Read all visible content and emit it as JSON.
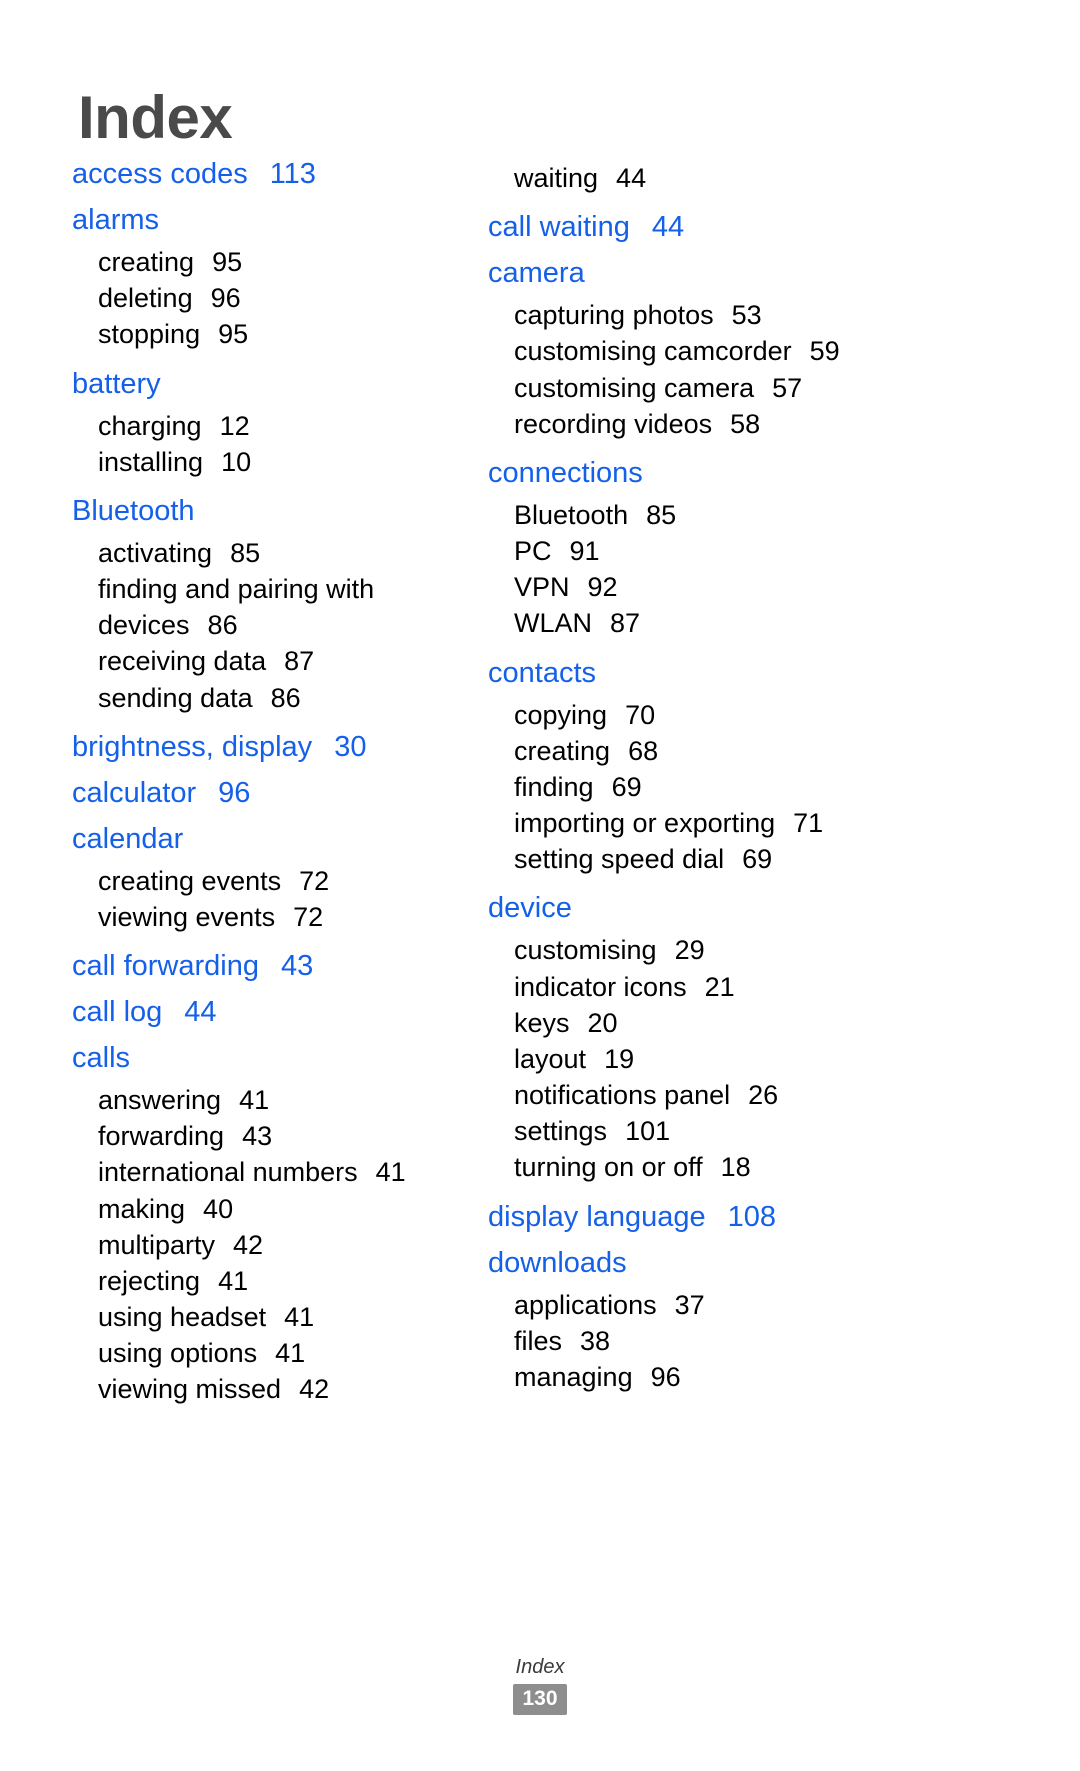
{
  "page": {
    "title": "Index",
    "footer_label": "Index",
    "footer_page_number": "130",
    "headword_color": "#1560e8",
    "title_color": "#4a4a4a",
    "subentry_color": "#000000",
    "page_box_color": "#8e8e8e"
  },
  "columns": [
    {
      "name": "left",
      "entries": [
        {
          "term": "access codes",
          "page": "113",
          "subentries": []
        },
        {
          "term": "alarms",
          "page": "",
          "subentries": [
            {
              "label": "creating",
              "page": "95"
            },
            {
              "label": "deleting",
              "page": "96"
            },
            {
              "label": "stopping",
              "page": "95"
            }
          ]
        },
        {
          "term": "battery",
          "page": "",
          "subentries": [
            {
              "label": "charging",
              "page": "12"
            },
            {
              "label": "installing",
              "page": "10"
            }
          ]
        },
        {
          "term": "Bluetooth",
          "page": "",
          "subentries": [
            {
              "label": "activating",
              "page": "85"
            },
            {
              "label": "finding and pairing with devices",
              "page": "86",
              "wrap": true
            },
            {
              "label": "receiving data",
              "page": "87"
            },
            {
              "label": "sending data",
              "page": "86"
            }
          ]
        },
        {
          "term": "brightness, display",
          "page": "30",
          "subentries": []
        },
        {
          "term": "calculator",
          "page": "96",
          "subentries": []
        },
        {
          "term": "calendar",
          "page": "",
          "subentries": [
            {
              "label": "creating events",
              "page": "72"
            },
            {
              "label": "viewing events",
              "page": "72"
            }
          ]
        },
        {
          "term": "call forwarding",
          "page": "43",
          "subentries": []
        },
        {
          "term": "call log",
          "page": "44",
          "subentries": []
        },
        {
          "term": "calls",
          "page": "",
          "subentries": [
            {
              "label": "answering",
              "page": "41"
            },
            {
              "label": "forwarding",
              "page": "43"
            },
            {
              "label": "international numbers",
              "page": "41"
            },
            {
              "label": "making",
              "page": "40"
            },
            {
              "label": "multiparty",
              "page": "42"
            },
            {
              "label": "rejecting",
              "page": "41"
            },
            {
              "label": "using headset",
              "page": "41"
            },
            {
              "label": "using options",
              "page": "41"
            },
            {
              "label": "viewing missed",
              "page": "42"
            }
          ]
        }
      ]
    },
    {
      "name": "right",
      "continued_subentries": [
        {
          "label": "waiting",
          "page": "44"
        }
      ],
      "entries": [
        {
          "term": "call waiting",
          "page": "44",
          "subentries": []
        },
        {
          "term": "camera",
          "page": "",
          "subentries": [
            {
              "label": "capturing photos",
              "page": "53"
            },
            {
              "label": "customising camcorder",
              "page": "59"
            },
            {
              "label": "customising camera",
              "page": "57"
            },
            {
              "label": "recording videos",
              "page": "58"
            }
          ]
        },
        {
          "term": "connections",
          "page": "",
          "subentries": [
            {
              "label": "Bluetooth",
              "page": "85"
            },
            {
              "label": "PC",
              "page": "91"
            },
            {
              "label": "VPN",
              "page": "92"
            },
            {
              "label": "WLAN",
              "page": "87"
            }
          ]
        },
        {
          "term": "contacts",
          "page": "",
          "subentries": [
            {
              "label": "copying",
              "page": "70"
            },
            {
              "label": "creating",
              "page": "68"
            },
            {
              "label": "finding",
              "page": "69"
            },
            {
              "label": "importing or exporting",
              "page": "71"
            },
            {
              "label": "setting speed dial",
              "page": "69"
            }
          ]
        },
        {
          "term": "device",
          "page": "",
          "subentries": [
            {
              "label": "customising",
              "page": "29"
            },
            {
              "label": "indicator icons",
              "page": "21"
            },
            {
              "label": "keys",
              "page": "20"
            },
            {
              "label": "layout",
              "page": "19"
            },
            {
              "label": "notifications panel",
              "page": "26"
            },
            {
              "label": "settings",
              "page": "101"
            },
            {
              "label": "turning on or off",
              "page": "18"
            }
          ]
        },
        {
          "term": "display language",
          "page": "108",
          "subentries": []
        },
        {
          "term": "downloads",
          "page": "",
          "subentries": [
            {
              "label": "applications",
              "page": "37"
            },
            {
              "label": "files",
              "page": "38"
            },
            {
              "label": "managing",
              "page": "96"
            }
          ]
        }
      ]
    }
  ]
}
